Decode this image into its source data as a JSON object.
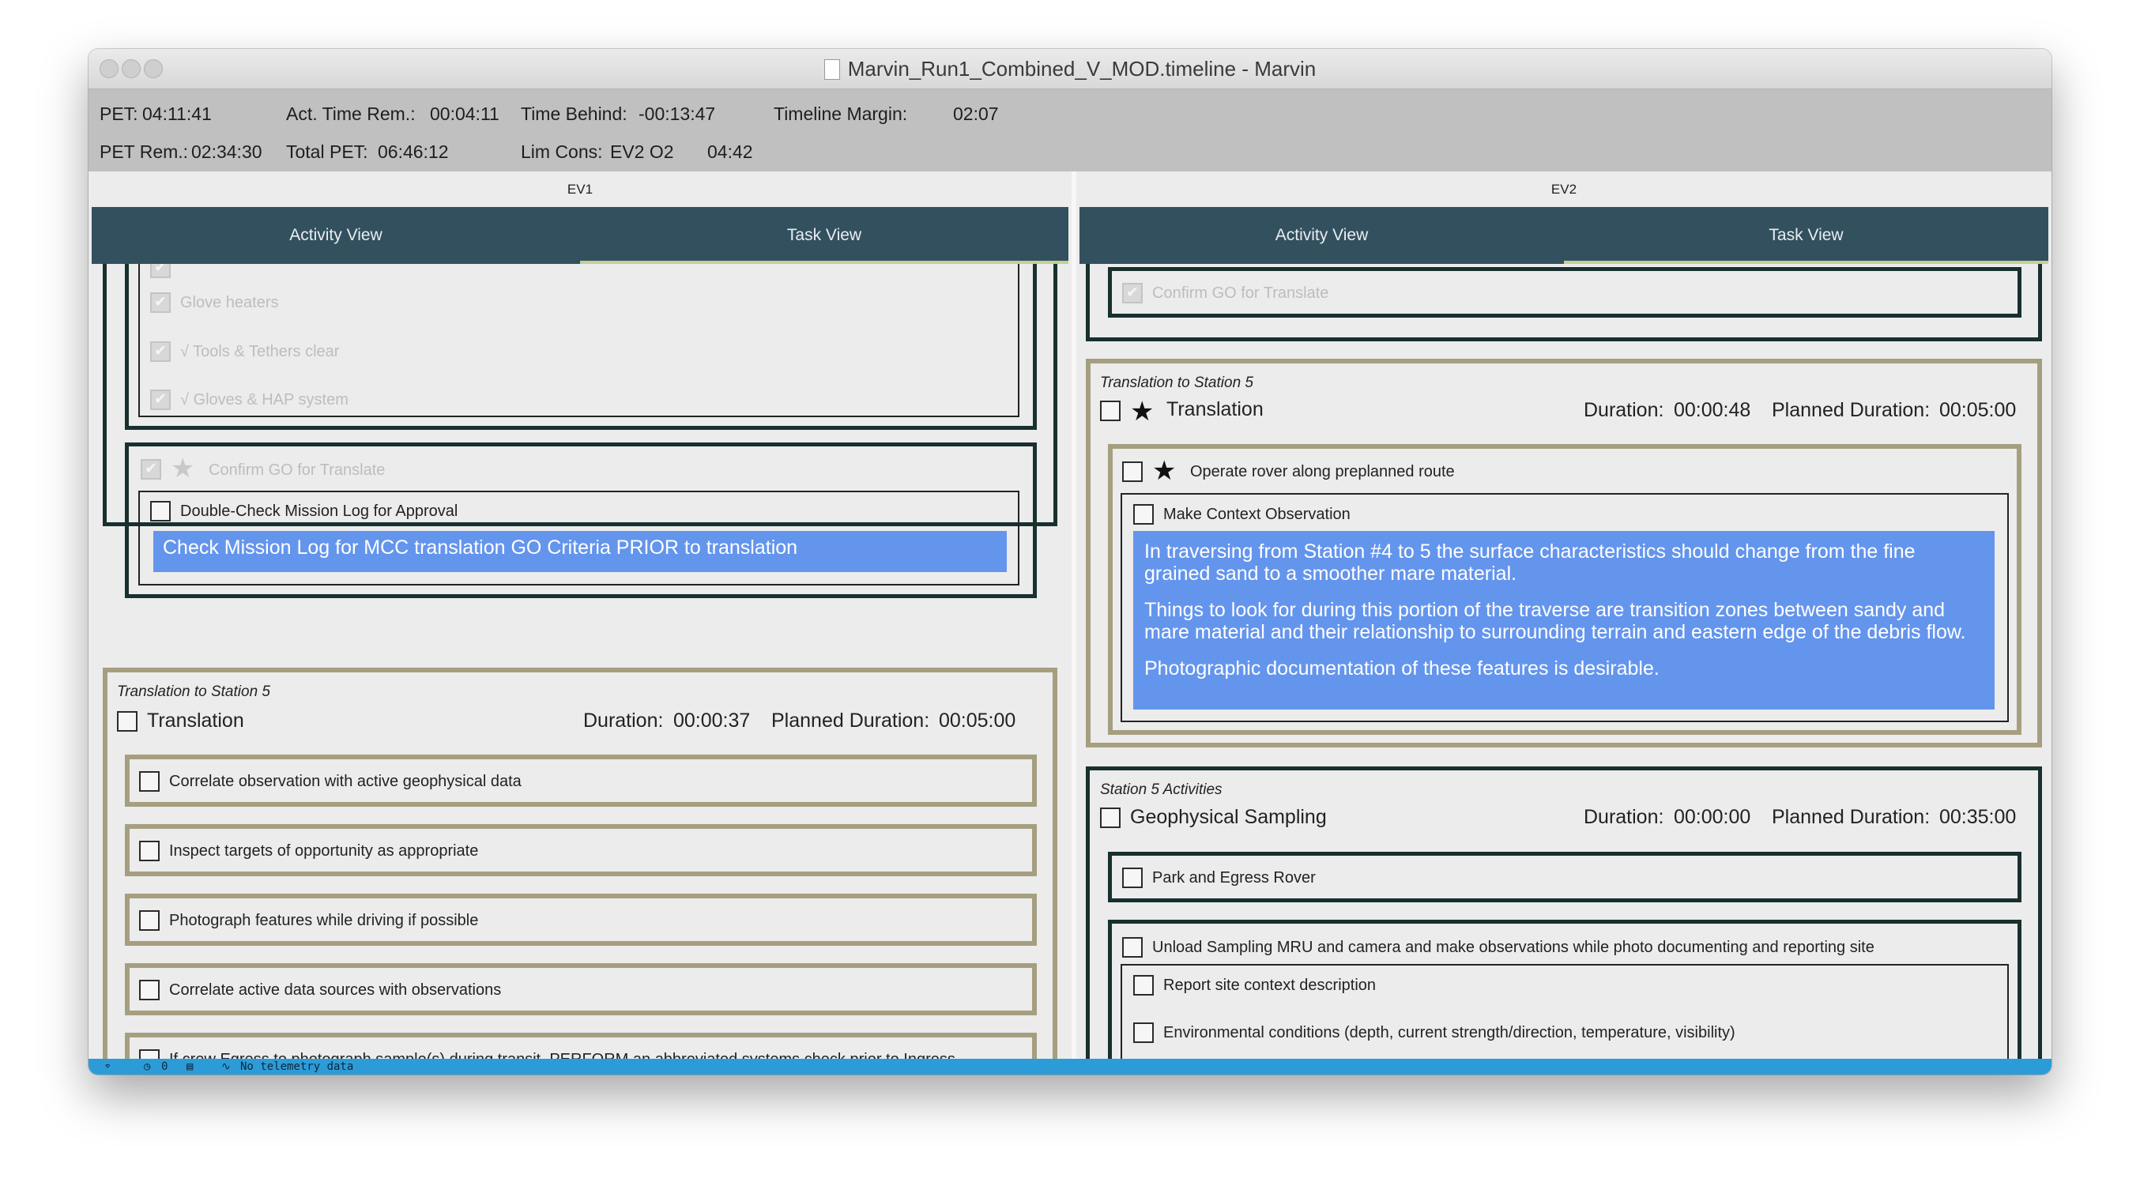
{
  "window": {
    "title": "Marvin_Run1_Combined_V_MOD.timeline - Marvin"
  },
  "info": {
    "pet_label": "PET:",
    "pet_value": "04:11:41",
    "act_time_rem_label": "Act. Time Rem.:",
    "act_time_rem_value": "00:04:11",
    "time_behind_label": "Time Behind:",
    "time_behind_value": "-00:13:47",
    "timeline_margin_label": "Timeline Margin:",
    "timeline_margin_value": "02:07",
    "pet_rem_label": "PET Rem.:",
    "pet_rem_value": "02:34:30",
    "total_pet_label": "Total PET:",
    "total_pet_value": "06:46:12",
    "lim_cons_label": "Lim Cons:",
    "lim_cons_value": "EV2 O2",
    "lim_cons_time": "04:42"
  },
  "tabs": {
    "activity": "Activity View",
    "task": "Task View",
    "active": "Task View"
  },
  "ev1": {
    "label": "EV1",
    "items": {
      "glove_heaters": "Glove heaters",
      "tools_tethers": "√ Tools & Tethers clear",
      "gloves_hap": "√ Gloves & HAP system",
      "confirm_go": "Confirm GO for Translate",
      "double_check": "Double-Check Mission Log for Approval",
      "check_note": "Check Mission Log for MCC translation GO Criteria PRIOR to translation"
    },
    "translation": {
      "category": "Translation to Station 5",
      "title": "Translation",
      "duration_label": "Duration:",
      "duration": "00:00:37",
      "planned_label": "Planned Duration:",
      "planned": "00:05:00",
      "tasks": [
        "Correlate observation with active geophysical data",
        "Inspect targets of opportunity as appropriate",
        "Photograph features while driving if possible",
        "Correlate active data sources with observations",
        "If crew Egress to photograph sample(s) during transit. PERFORM an abbreviated systems check prior to Ingress"
      ]
    }
  },
  "ev2": {
    "label": "EV2",
    "confirm_go": "Confirm GO for Translate",
    "translation": {
      "category": "Translation to Station 5",
      "title": "Translation",
      "duration_label": "Duration:",
      "duration": "00:00:48",
      "planned_label": "Planned Duration:",
      "planned": "00:05:00",
      "operate": "Operate rover along preplanned route",
      "context_obs": "Make Context Observation",
      "note": [
        "In traversing from Station #4 to 5 the surface characteristics should change from the fine grained sand to a smoother mare material.",
        "Things to look for during this portion of the traverse are transition zones between sandy and mare material and their relationship to surrounding terrain and eastern edge of the debris flow.",
        "Photographic documentation of these features is desirable."
      ]
    },
    "station5": {
      "category": "Station 5 Activities",
      "title": "Geophysical Sampling",
      "duration_label": "Duration:",
      "duration": "00:00:00",
      "planned_label": "Planned Duration:",
      "planned": "00:35:00",
      "park": "Park and Egress Rover",
      "unload": "Unload Sampling MRU and camera and make observations while photo documenting and reporting site",
      "report": "Report site context description",
      "env": "Environmental conditions (depth, current strength/direction, temperature, visibility)"
    }
  },
  "status": {
    "count": "0",
    "telemetry": "No telemetry data"
  },
  "colors": {
    "tab_bar": "#33505f",
    "note_bg": "#6495ed",
    "status_bar": "#2c9cd9",
    "olive_border": "#a59f80",
    "dark_border": "#18302e"
  }
}
